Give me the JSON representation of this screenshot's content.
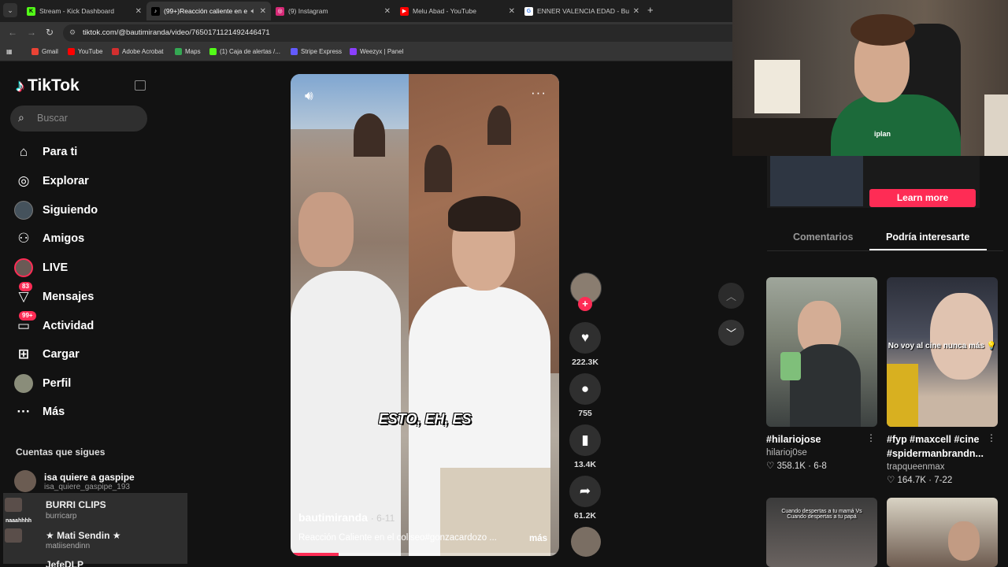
{
  "browser": {
    "tabs": [
      {
        "title": "Stream - Kick Dashboard",
        "icon": "kick-icon",
        "active": false
      },
      {
        "title": "(99+)Reacción caliente en el coliseo",
        "icon": "tiktok-icon",
        "active": true
      },
      {
        "title": "(9) Instagram",
        "icon": "instagram-icon",
        "active": false
      },
      {
        "title": "Melu Abad - YouTube",
        "icon": "youtube-icon",
        "active": false
      },
      {
        "title": "ENNER VALENCIA EDAD - Buscar",
        "icon": "google-icon",
        "active": false
      }
    ],
    "url": "tiktok.com/@bautimiranda/video/7650171121492446471",
    "bookmarks": [
      {
        "label": "Gmail",
        "color": "#ea4335"
      },
      {
        "label": "YouTube",
        "color": "#ff0000"
      },
      {
        "label": "Adobe Acrobat",
        "color": "#d32f2f"
      },
      {
        "label": "Maps",
        "color": "#34a853"
      },
      {
        "label": "(1) Caja de alertas /...",
        "color": "#53fc18"
      },
      {
        "label": "Stripe Express",
        "color": "#635bff"
      },
      {
        "label": "Weezyx | Panel",
        "color": "#8a3ffc"
      }
    ]
  },
  "sidebar": {
    "logo": "TikTok",
    "search_placeholder": "Buscar",
    "nav": [
      {
        "label": "Para ti",
        "icon": "home-icon"
      },
      {
        "label": "Explorar",
        "icon": "compass-icon"
      },
      {
        "label": "Siguiendo",
        "icon": "following-avatar-icon"
      },
      {
        "label": "Amigos",
        "icon": "friends-icon"
      },
      {
        "label": "LIVE",
        "icon": "live-icon"
      },
      {
        "label": "Mensajes",
        "icon": "messages-icon",
        "badge": "83"
      },
      {
        "label": "Actividad",
        "icon": "activity-icon",
        "badge": "99+"
      },
      {
        "label": "Cargar",
        "icon": "upload-icon"
      },
      {
        "label": "Perfil",
        "icon": "profile-avatar-icon"
      },
      {
        "label": "Más",
        "icon": "more-icon"
      }
    ],
    "following_header": "Cuentas que sigues",
    "following": [
      {
        "name": "isa quiere a gaspipe",
        "handle": "isa_quiere_gaspipe_193"
      }
    ],
    "chat_overlay": [
      {
        "name": "BURRI CLIPS",
        "handle": "burricarp",
        "thumb": "naaahhhh"
      },
      {
        "name": "★ Mati Sendin ★",
        "handle": "matiisendinn"
      },
      {
        "name": "JefeDLP",
        "handle": ""
      }
    ]
  },
  "video": {
    "caption_overlay": "ESTO, EH, ES",
    "author": "bautimiranda",
    "date": "6-11",
    "description": "Reacción Caliente en el coliseo#gonzacardozo ...",
    "more_label": "más",
    "progress": 0.18
  },
  "actions": {
    "likes": "222.3K",
    "comments": "755",
    "saves": "13.4K",
    "shares": "61.2K"
  },
  "right_panel": {
    "learn_more": "Learn more",
    "tabs": [
      "Comentarios",
      "Podría interesarte"
    ],
    "active_tab": 1,
    "cards": [
      {
        "title": "#hilariojose",
        "user": "hilarioj0se",
        "likes": "358.1K",
        "date": "6-8",
        "overlay": ""
      },
      {
        "title": "#fyp #maxcell #cine #spidermanbrandn...",
        "user": "trapqueenmax",
        "likes": "164.7K",
        "date": "7-22",
        "overlay": "No voy al cine nunca más 💡"
      },
      {
        "title": "",
        "user": "",
        "likes": "",
        "date": "",
        "overlay": "Cuando despertas a tu mamá Vs Cuando despertas a tu papá"
      },
      {
        "title": "",
        "user": "",
        "likes": "",
        "date": "",
        "overlay": ""
      }
    ]
  },
  "webcam": {
    "shirt_text": "iplan"
  },
  "colors": {
    "accent": "#fe2c55",
    "background": "#121212"
  }
}
